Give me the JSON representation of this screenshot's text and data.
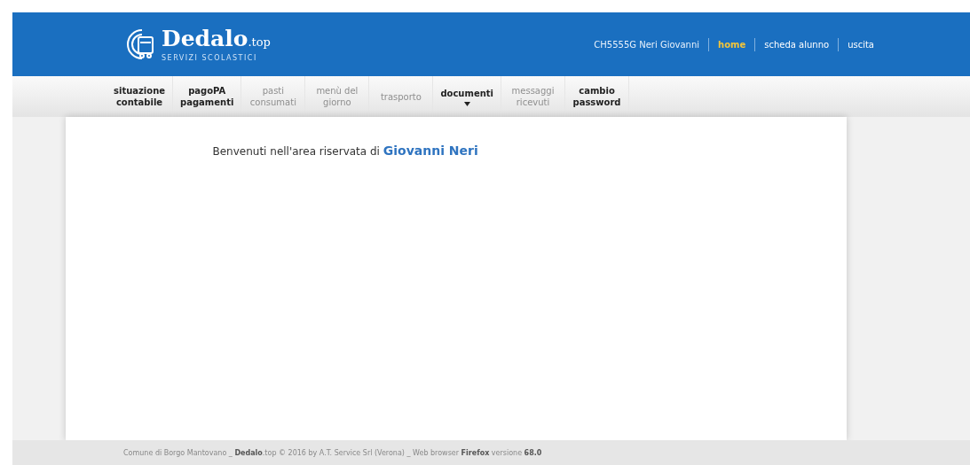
{
  "header": {
    "logo": {
      "name": "Dedalo",
      "suffix": ".top",
      "tagline": "SERVIZI SCOLASTICI"
    },
    "user": "CH5555G  Neri Giovanni",
    "links": [
      {
        "label": "home",
        "selected": true
      },
      {
        "label": "scheda alunno",
        "selected": false
      },
      {
        "label": "uscita",
        "selected": false
      }
    ]
  },
  "nav": [
    {
      "lines": [
        "situazione",
        "contabile"
      ],
      "disabled": false,
      "dropdown": false
    },
    {
      "lines": [
        "pagoPA",
        "pagamenti"
      ],
      "disabled": false,
      "dropdown": false
    },
    {
      "lines": [
        "pasti",
        "consumati"
      ],
      "disabled": true,
      "dropdown": false
    },
    {
      "lines": [
        "menù del",
        "giorno"
      ],
      "disabled": true,
      "dropdown": false
    },
    {
      "lines": [
        "trasporto"
      ],
      "disabled": true,
      "dropdown": false
    },
    {
      "lines": [
        "documenti"
      ],
      "disabled": false,
      "dropdown": true
    },
    {
      "lines": [
        "messaggi",
        "ricevuti"
      ],
      "disabled": true,
      "dropdown": false
    },
    {
      "lines": [
        "cambio",
        "password"
      ],
      "disabled": false,
      "dropdown": false
    }
  ],
  "welcome": {
    "text": "Benvenuti nell'area riservata di",
    "name": "Giovanni Neri"
  },
  "footer": "Comune di Borgo Mantovano _ **Dedalo**.top © 2016 by A.T. Service Srl (Verona) _ Web browser **Firefox** versione **68.0**"
}
